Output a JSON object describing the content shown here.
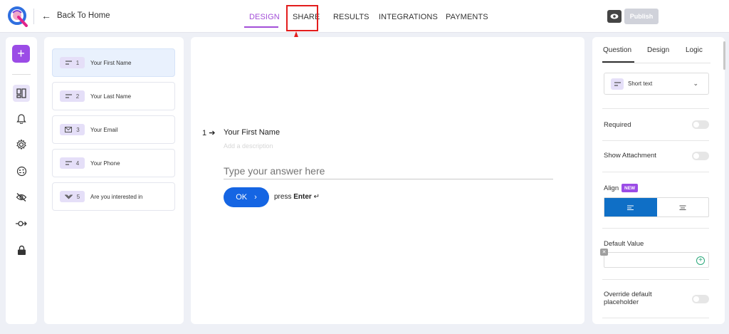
{
  "header": {
    "back_label": "Back To Home",
    "tabs": [
      {
        "label": "DESIGN",
        "active": true
      },
      {
        "label": "SHARE",
        "active": false
      },
      {
        "label": "RESULTS",
        "active": false
      },
      {
        "label": "INTEGRATIONS",
        "active": false
      },
      {
        "label": "PAYMENTS",
        "active": false
      }
    ],
    "publish_label": "Publish",
    "accent_color": "#a34fd8",
    "highlight_color": "#e31d1d"
  },
  "rail": {
    "icons": [
      "plus-icon",
      "layout-icon",
      "bell-icon",
      "gear-icon",
      "palette-icon",
      "eye-off-icon",
      "logic-icon",
      "lock-icon"
    ]
  },
  "questions": [
    {
      "num": "1",
      "label": "Your First Name",
      "icon": "short-text-icon",
      "active": true
    },
    {
      "num": "2",
      "label": "Your Last Name",
      "icon": "short-text-icon",
      "active": false
    },
    {
      "num": "3",
      "label": "Your Email",
      "icon": "mail-icon",
      "active": false
    },
    {
      "num": "4",
      "label": "Your Phone",
      "icon": "short-text-icon",
      "active": false
    },
    {
      "num": "5",
      "label": "Are you interested in",
      "icon": "chevron-down-icon",
      "active": false
    }
  ],
  "canvas": {
    "question_number": "1",
    "question_title": "Your First Name",
    "description_placeholder": "Add a description",
    "answer_placeholder": "Type your answer here",
    "ok_label": "OK",
    "press_label": "press",
    "enter_label": "Enter"
  },
  "settings": {
    "tabs": [
      {
        "label": "Question",
        "active": true
      },
      {
        "label": "Design",
        "active": false
      },
      {
        "label": "Logic",
        "active": false
      }
    ],
    "question_type": "Short text",
    "required_label": "Required",
    "show_attachment_label": "Show Attachment",
    "align_label": "Align",
    "new_badge": "NEW",
    "default_value_label": "Default Value",
    "override_label_line1": "Override default",
    "override_label_line2": "placeholder",
    "align_active_color": "#0f6fc6"
  }
}
